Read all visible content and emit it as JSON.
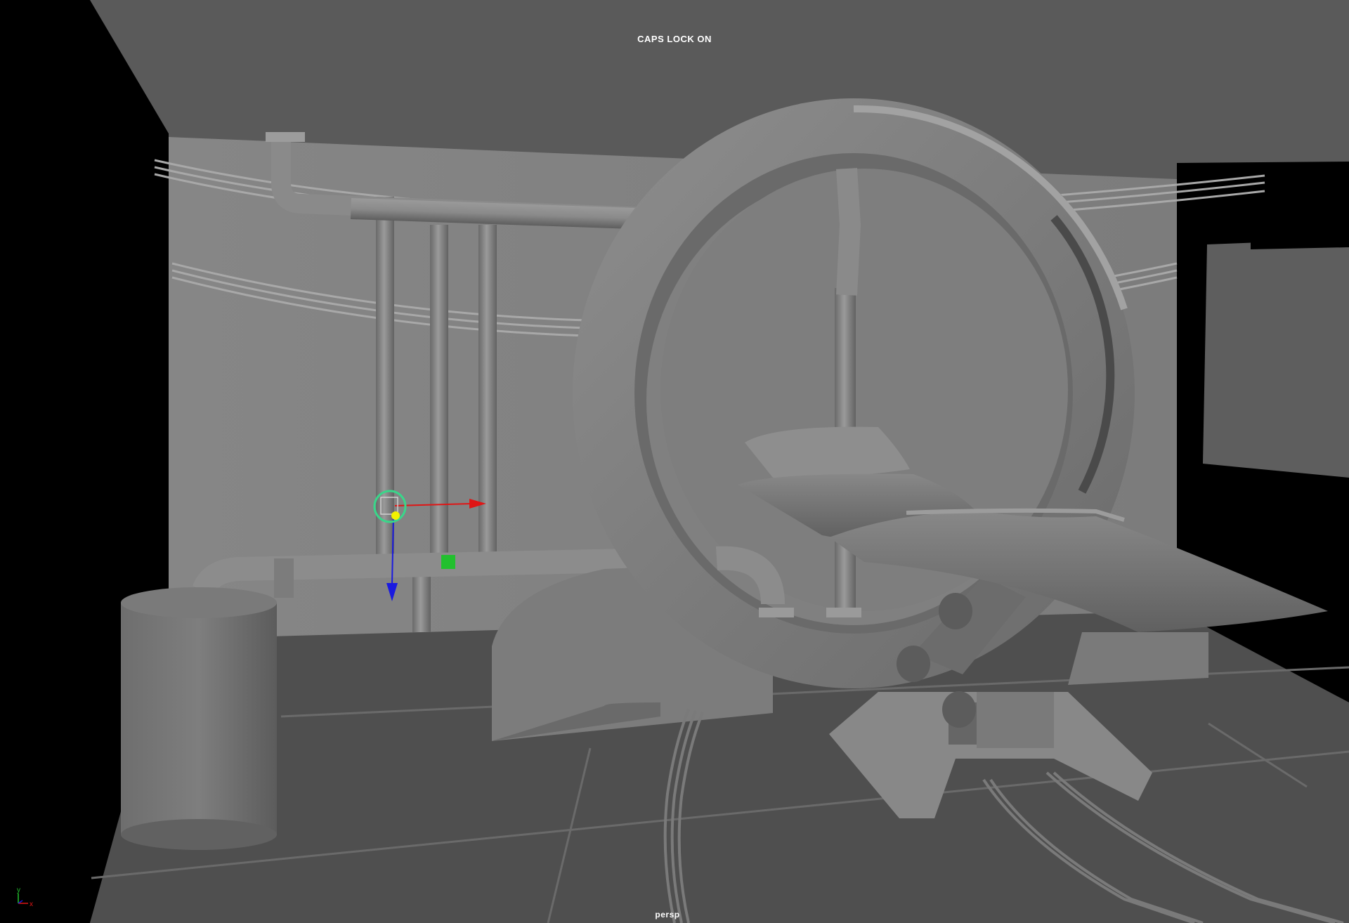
{
  "viewport": {
    "status_message": "CAPS LOCK ON",
    "camera_name": "persp",
    "axis_labels": {
      "y": "y",
      "x": "x"
    }
  },
  "colors": {
    "background": "#5a5a5a",
    "wall": "#7a7a7a",
    "floor": "#4e4e4e",
    "model_light": "#909090",
    "model_mid": "#6e6e6e",
    "model_dark": "#454545",
    "void": "#000000",
    "manip_x": "#e01515",
    "manip_y": "#1a1ae0",
    "manip_z": "#22c02e",
    "manip_center": "#f2f200",
    "manip_ring": "#3ad68a"
  },
  "icons": {
    "axis_indicator": "axis-gizmo-icon",
    "move_manipulator": "move-tool-manipulator-icon"
  }
}
